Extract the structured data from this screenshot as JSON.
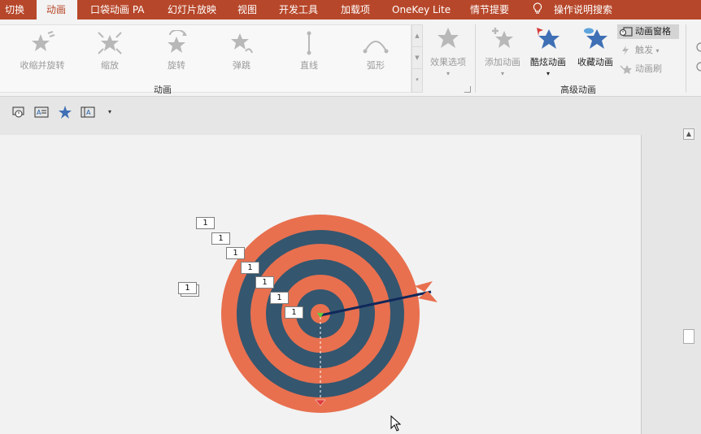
{
  "tabs": [
    {
      "label": "切换",
      "active": false
    },
    {
      "label": "动画",
      "active": true
    },
    {
      "label": "口袋动画 PA",
      "active": false
    },
    {
      "label": "幻灯片放映",
      "active": false
    },
    {
      "label": "视图",
      "active": false
    },
    {
      "label": "开发工具",
      "active": false
    },
    {
      "label": "加载项",
      "active": false
    },
    {
      "label": "OneKey Lite",
      "active": false
    },
    {
      "label": "情节提要",
      "active": false
    },
    {
      "label": "操作说明搜索",
      "active": false
    }
  ],
  "gallery": {
    "items": [
      "收缩并旋转",
      "缩放",
      "旋转",
      "弹跳",
      "直线",
      "弧形"
    ],
    "effect_options": "效果选项",
    "group_label": "动画"
  },
  "advanced": {
    "add_animation": "添加动画",
    "cool_animation": "酷炫动画",
    "favorite_animation": "收藏动画",
    "animation_pane": "动画窗格",
    "trigger": "触发",
    "animation_painter": "动画刷",
    "group_label": "高级动画"
  },
  "slide": {
    "order_tags": [
      "1",
      "1",
      "1",
      "1",
      "1",
      "1",
      "1"
    ],
    "stacked_tag": "1"
  },
  "colors": {
    "accent": "#b7472a",
    "ring_orange": "#e8704f",
    "ring_blue": "#34566f",
    "arrow_shaft": "#10285a"
  },
  "icons": [
    "star-shrink-spin-icon",
    "star-zoom-icon",
    "star-spin-icon",
    "star-bounce-icon",
    "line-path-icon",
    "arc-path-icon",
    "lightbulb-icon",
    "animation-pane-icon",
    "trigger-icon",
    "animation-painter-icon",
    "cursor-icon"
  ]
}
